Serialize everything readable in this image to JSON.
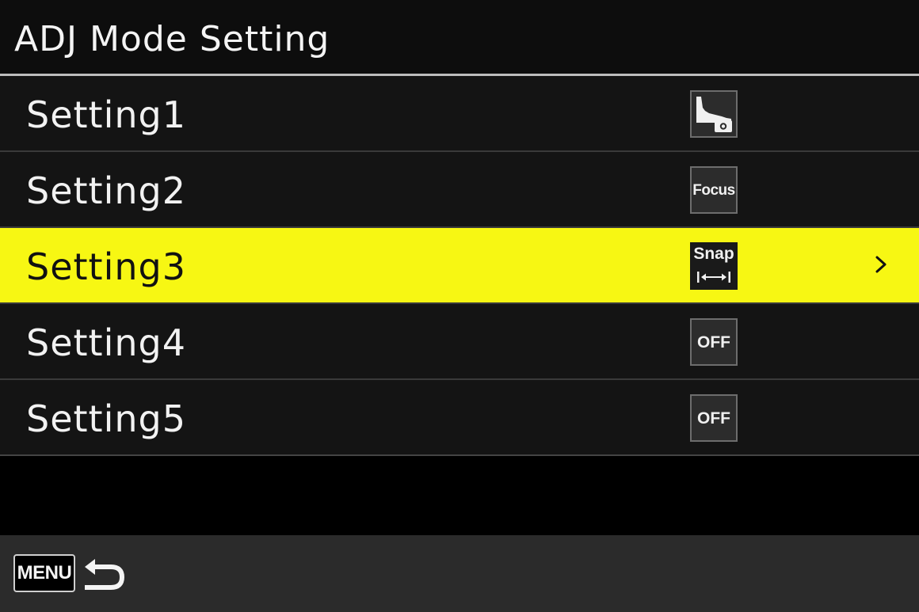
{
  "header": {
    "title": "ADJ Mode Setting"
  },
  "menu": {
    "items": [
      {
        "label": "Setting1",
        "icon": "histogram-camera-icon",
        "value_text": "",
        "selected": false
      },
      {
        "label": "Setting2",
        "icon": "focus-icon",
        "value_text": "Focus",
        "selected": false
      },
      {
        "label": "Setting3",
        "icon": "snap-distance-icon",
        "value_text": "Snap",
        "selected": true
      },
      {
        "label": "Setting4",
        "icon": "off-icon",
        "value_text": "OFF",
        "selected": false
      },
      {
        "label": "Setting5",
        "icon": "off-icon",
        "value_text": "OFF",
        "selected": false
      }
    ]
  },
  "footer": {
    "menu_key_label": "MENU",
    "back_icon": "return-arrow-icon"
  },
  "colors": {
    "highlight": "#f7f713",
    "row_background": "#141414",
    "footer_background": "#2b2b2b",
    "text": "#f2f2f2"
  }
}
